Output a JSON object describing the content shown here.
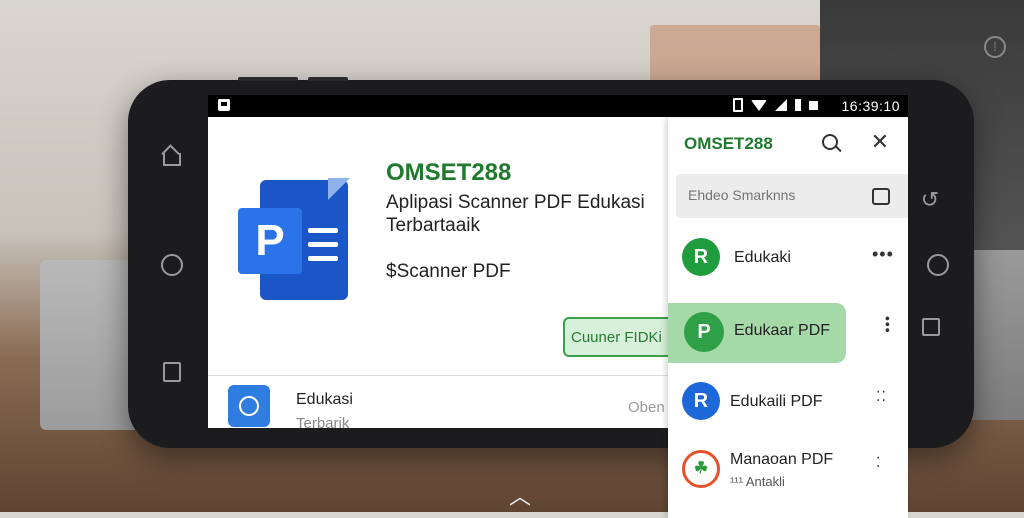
{
  "status_bar": {
    "time": "16:39:10"
  },
  "app": {
    "brand": "OMSET288",
    "title": "Aplipasi Scanner PDF Edukasi Terbartaaik",
    "subtitle": "$Scanner PDF",
    "install_label": "Cuuner FIDKi",
    "logo_letter": "P"
  },
  "list_item": {
    "title": "Edukasi",
    "subtitle": "Terbarik",
    "action": "Oben"
  },
  "panel": {
    "brand": "OMSET288",
    "search_placeholder": "Ehdeo Smarknns",
    "items": [
      {
        "avatar": "R",
        "label": "Edukaki",
        "color": "#1f9d3d"
      },
      {
        "avatar": "P",
        "label": "Edukaar PDF",
        "color": "#2fa048"
      },
      {
        "avatar": "R",
        "label": "Edukaili PDF",
        "color": "#1c68d8"
      },
      {
        "avatar": "☘",
        "label": "Manaoan PDF",
        "sub": "¹¹¹ Antakli",
        "color": "#e8502a"
      }
    ]
  },
  "icons": {
    "info": "info-icon",
    "search": "search-icon",
    "close": "close-icon",
    "more": "more-icon"
  }
}
